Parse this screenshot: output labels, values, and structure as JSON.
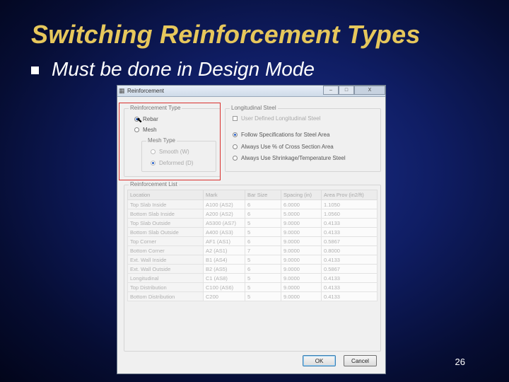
{
  "slide": {
    "title": "Switching Reinforcement Types",
    "bullet": "Must be done in Design Mode",
    "page_number": "26"
  },
  "dialog": {
    "title": "Reinforcement",
    "controls": {
      "minimize": "–",
      "maximize": "□",
      "close": "X"
    },
    "reinforcement_type": {
      "label": "Reinforcement Type",
      "rebar": "Rebar",
      "mesh": "Mesh",
      "selected": "Rebar",
      "mesh_type": {
        "label": "Mesh Type",
        "smooth": "Smooth (W)",
        "deformed": "Deformed (D)"
      }
    },
    "longitudinal_steel": {
      "label": "Longitudinal Steel",
      "user_defined": "User Defined Longitudinal Steel",
      "follow_specs": "Follow Specifications for Steel Area",
      "always_use_pct": "Always Use % of Cross Section Area",
      "always_use_shrinkage": "Always Use Shrinkage/Temperature Steel",
      "selected": "Follow Specifications for Steel Area"
    },
    "reinforcement_list": {
      "label": "Reinforcement List",
      "columns": [
        "Location",
        "Mark",
        "Bar Size",
        "Spacing (in)",
        "Area Prov (in2/ft)"
      ],
      "rows": [
        [
          "Top Slab Inside",
          "A100 (AS2)",
          "6",
          "6.0000",
          "1.1050"
        ],
        [
          "Bottom Slab Inside",
          "A200 (AS2)",
          "6",
          "5.0000",
          "1.0560"
        ],
        [
          "Top Slab Outside",
          "A5300 (AS7)",
          "5",
          "9.0000",
          "0.4133"
        ],
        [
          "Bottom Slab Outside",
          "A400 (AS3)",
          "5",
          "9.0000",
          "0.4133"
        ],
        [
          "Top Corner",
          "AF1 (AS1)",
          "6",
          "9.0000",
          "0.5867"
        ],
        [
          "Bottom Corner",
          "A2 (AS1)",
          "7",
          "9.0000",
          "0.8000"
        ],
        [
          "Ext. Wall Inside",
          "B1 (AS4)",
          "5",
          "9.0000",
          "0.4133"
        ],
        [
          "Ext. Wall Outside",
          "B2 (AS5)",
          "6",
          "9.0000",
          "0.5867"
        ],
        [
          "Longitudinal",
          "C1 (AS8)",
          "5",
          "9.0000",
          "0.4133"
        ],
        [
          "Top Distribution",
          "C100 (AS6)",
          "5",
          "9.0000",
          "0.4133"
        ],
        [
          "Bottom Distribution",
          "C200",
          "5",
          "9.0000",
          "0.4133"
        ]
      ]
    },
    "buttons": {
      "ok": "OK",
      "cancel": "Cancel"
    }
  }
}
